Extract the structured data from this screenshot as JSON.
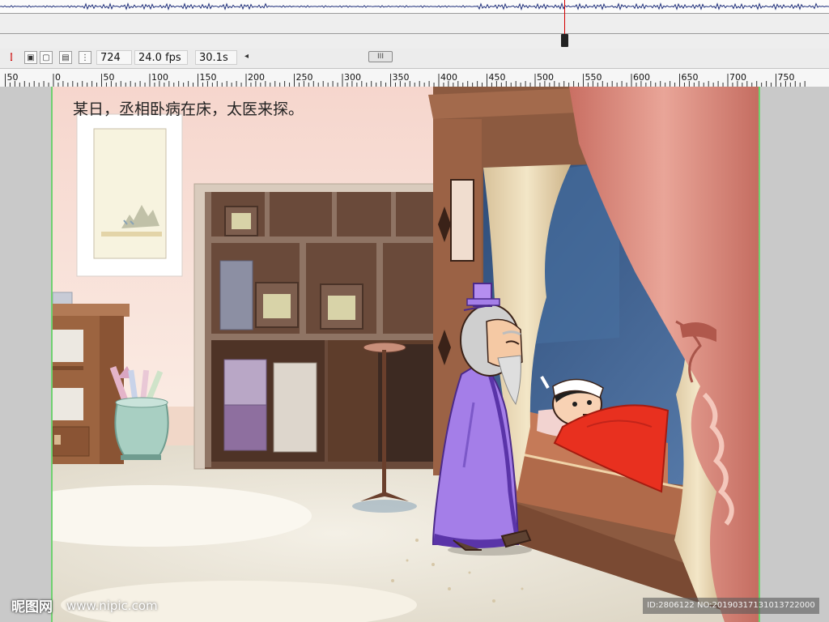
{
  "timeline": {
    "frame": "724",
    "fps": "24.0 fps",
    "time": "30.1s",
    "scroll_arrow": "◂",
    "scroll_thumb": "III"
  },
  "ruler": {
    "labels": [
      "50",
      "0",
      "50",
      "100",
      "150",
      "200",
      "250",
      "300",
      "350",
      "400",
      "450",
      "500",
      "550",
      "600",
      "650",
      "700",
      "750"
    ]
  },
  "stage": {
    "caption": "某日，丞相卧病在床，太医来探。"
  },
  "watermark": {
    "logo": "昵图网",
    "url": "www.nipic.com",
    "id": "ID:2806122 NO:20190317131013722000"
  },
  "colors": {
    "playhead": "#d40000",
    "stage_border": "#6fd16f",
    "robe": "#a47ee8",
    "quilt": "#e8301f",
    "curtain": "#d98a7a"
  }
}
